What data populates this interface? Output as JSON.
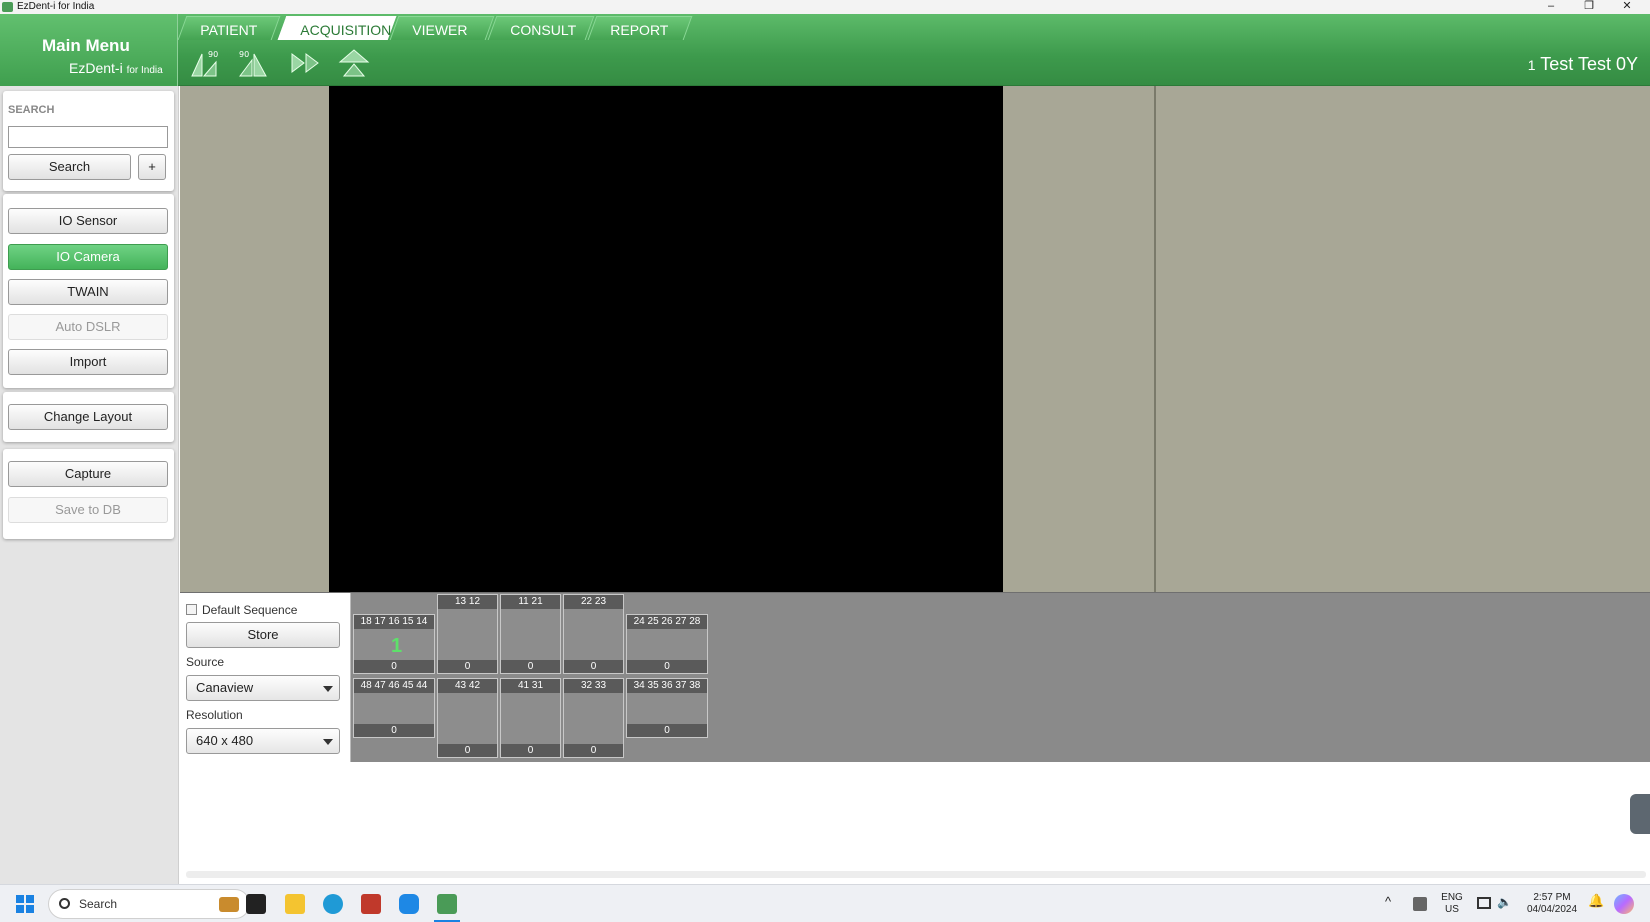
{
  "window": {
    "title": "EzDent-i for India",
    "minimize": "–",
    "restore": "❐",
    "close": "✕"
  },
  "header": {
    "menu_title": "Main Menu",
    "brand": "EzDent-i",
    "brand_suffix": "for India",
    "tabs": [
      {
        "label": "PATIENT",
        "active": false
      },
      {
        "label": "ACQUISITION",
        "active": true
      },
      {
        "label": "VIEWER",
        "active": false
      },
      {
        "label": "CONSULT",
        "active": false
      },
      {
        "label": "REPORT",
        "active": false
      }
    ],
    "rotate_label": "90",
    "patient_number": "1",
    "patient_name": "Test Test 0Y"
  },
  "sidebar": {
    "search_label": "SEARCH",
    "search_value": "",
    "search_button": "Search",
    "add_button": "+",
    "sources": [
      "IO Sensor",
      "IO Camera",
      "TWAIN",
      "Auto DSLR",
      "Import"
    ],
    "active_source": "IO Camera",
    "disabled_source": "Auto DSLR",
    "change_layout": "Change Layout",
    "capture": "Capture",
    "save_to_db": "Save to DB"
  },
  "acquisition": {
    "default_sequence_label": "Default Sequence",
    "default_sequence_checked": false,
    "store_button": "Store",
    "source_label": "Source",
    "source_value": "Canaview",
    "resolution_label": "Resolution",
    "resolution_value": "640 x 480"
  },
  "tooth_slots": [
    {
      "teeth": "18 17 16 15 14",
      "count": "0",
      "marker": "1"
    },
    {
      "teeth": "13 12",
      "count": "0",
      "marker": ""
    },
    {
      "teeth": "11 21",
      "count": "0",
      "marker": ""
    },
    {
      "teeth": "22 23",
      "count": "0",
      "marker": ""
    },
    {
      "teeth": "24 25 26 27 28",
      "count": "0",
      "marker": ""
    },
    {
      "teeth": "48 47 46 45 44",
      "count": "0",
      "marker": ""
    },
    {
      "teeth": "43 42",
      "count": "0",
      "marker": ""
    },
    {
      "teeth": "41 31",
      "count": "0",
      "marker": ""
    },
    {
      "teeth": "32 33",
      "count": "0",
      "marker": ""
    },
    {
      "teeth": "34 35 36 37 38",
      "count": "0",
      "marker": ""
    }
  ],
  "taskbar": {
    "search_placeholder": "Search",
    "lang_top": "ENG",
    "lang_bottom": "US",
    "time": "2:57 PM",
    "date": "04/04/2024"
  },
  "colors": {
    "header_green": "#3d9a4c",
    "active_button": "#44b35a",
    "preview_bg": "#a8a796"
  }
}
